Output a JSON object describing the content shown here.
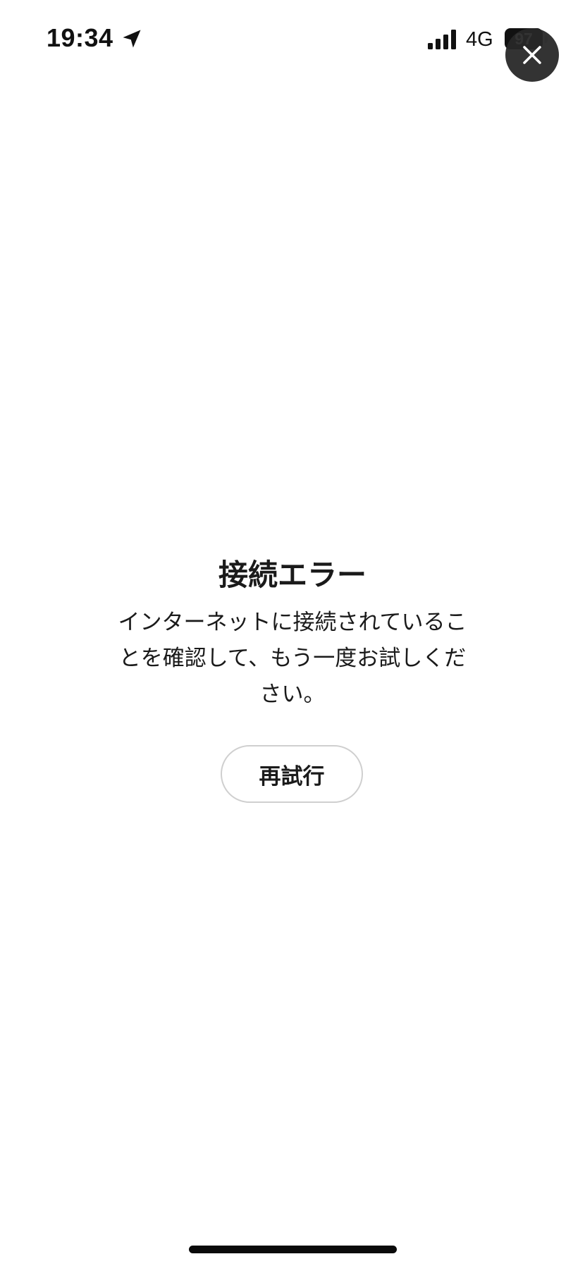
{
  "status_bar": {
    "time": "19:34",
    "network": "4G",
    "battery": "97",
    "location_icon": "location-arrow-icon",
    "signal_icon": "cellular-signal-icon"
  },
  "close_button": {
    "icon": "close-icon",
    "background": "#2a2a2a"
  },
  "error": {
    "title": "接続エラー",
    "message": "インターネットに接続されていることを確認して、もう一度お試しください。"
  },
  "retry_button": {
    "label": "再試行"
  },
  "colors": {
    "background": "#ffffff",
    "text": "#1a1a1a",
    "button_border": "#cfcfcf"
  }
}
